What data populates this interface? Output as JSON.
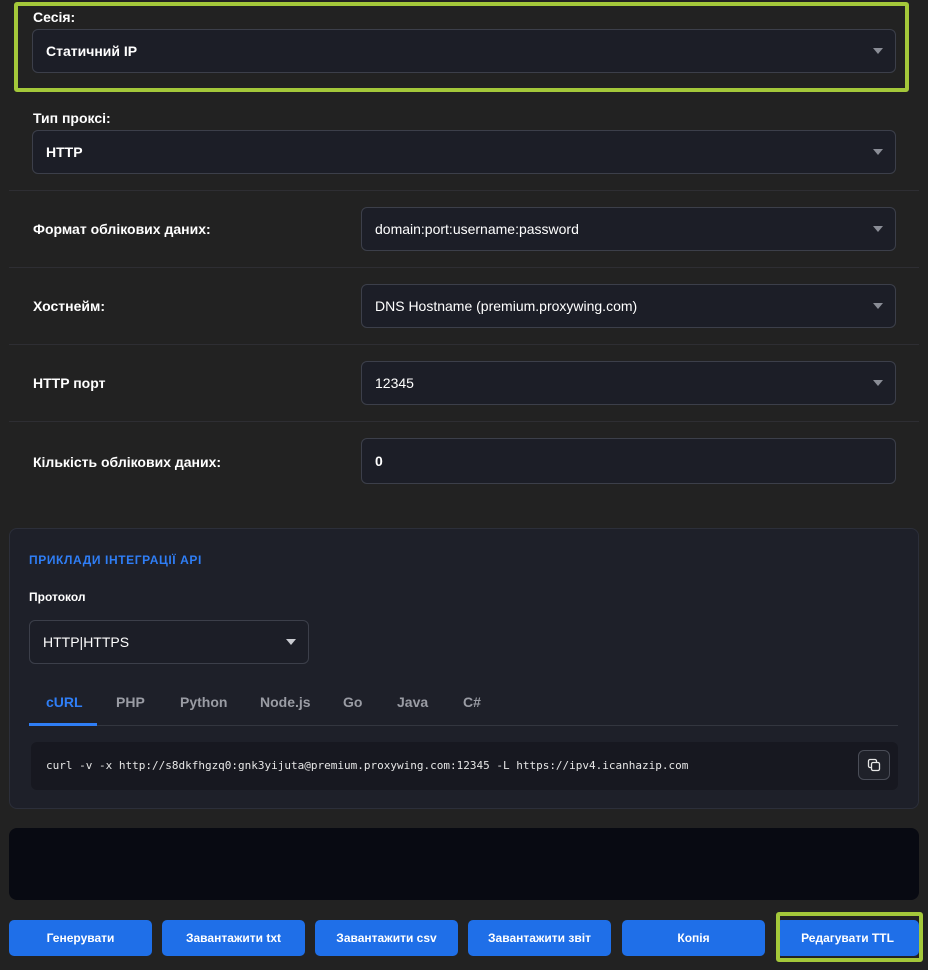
{
  "form": {
    "session": {
      "label": "Сесія:",
      "value": "Статичний IP"
    },
    "proxy_type": {
      "label": "Тип проксі:",
      "value": "HTTP"
    },
    "credentials_format": {
      "label": "Формат облікових даних:",
      "value": "domain:port:username:password"
    },
    "hostname": {
      "label": "Хостнейм:",
      "value": "DNS Hostname (premium.proxywing.com)"
    },
    "http_port": {
      "label": "HTTP порт",
      "value": "12345"
    },
    "credentials_count": {
      "label": "Кількість облікових даних:",
      "value": "0"
    }
  },
  "integration": {
    "title": "ПРИКЛАДИ ІНТЕГРАЦІЇ API",
    "protocol_label": "Протокол",
    "protocol_value": "HTTP|HTTPS",
    "tabs": [
      "cURL",
      "PHP",
      "Python",
      "Node.js",
      "Go",
      "Java",
      "C#"
    ],
    "active_tab": "cURL",
    "code": "curl -v -x http://s8dkfhgzq0:gnk3yijuta@premium.proxywing.com:12345 -L https://ipv4.icanhazip.com",
    "copy_icon": "copy-icon"
  },
  "buttons": {
    "generate": "Генерувати",
    "download_txt": "Завантажити txt",
    "download_csv": "Завантажити csv",
    "download_report": "Завантажити звіт",
    "copy": "Копія",
    "edit_ttl": "Редагувати TTL"
  },
  "colors": {
    "accent": "#1f6fe8",
    "highlight": "#a4c83a",
    "background": "#222222"
  }
}
